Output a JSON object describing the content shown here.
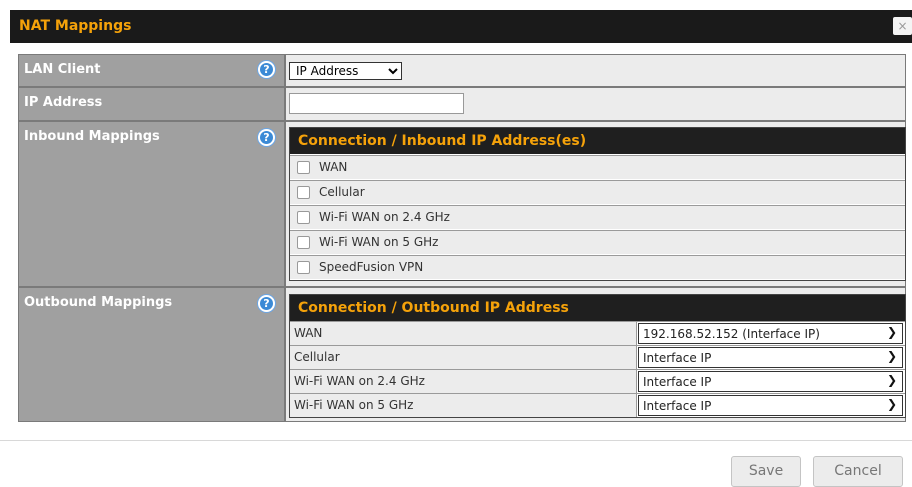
{
  "dialog": {
    "title": "NAT Mappings",
    "close_glyph": "×"
  },
  "lan_client": {
    "label": "LAN Client",
    "selected": "IP Address"
  },
  "ip_address": {
    "label": "IP Address",
    "value": ""
  },
  "inbound": {
    "label": "Inbound Mappings",
    "header": "Connection / Inbound IP Address(es)",
    "items": [
      {
        "label": "WAN",
        "checked": false
      },
      {
        "label": "Cellular",
        "checked": false
      },
      {
        "label": "Wi-Fi WAN on 2.4 GHz",
        "checked": false
      },
      {
        "label": "Wi-Fi WAN on 5 GHz",
        "checked": false
      },
      {
        "label": "SpeedFusion VPN",
        "checked": false
      }
    ]
  },
  "outbound": {
    "label": "Outbound Mappings",
    "header": "Connection / Outbound IP Address",
    "rows": [
      {
        "connection": "WAN",
        "value": "192.168.52.152 (Interface IP)"
      },
      {
        "connection": "Cellular",
        "value": "Interface IP"
      },
      {
        "connection": "Wi-Fi WAN on 2.4 GHz",
        "value": "Interface IP"
      },
      {
        "connection": "Wi-Fi WAN on 5 GHz",
        "value": "Interface IP"
      }
    ]
  },
  "help_glyph": "?",
  "buttons": {
    "save": "Save",
    "cancel": "Cancel"
  },
  "colors": {
    "title_bar": "#1a1a1a",
    "accent": "#f5a20a",
    "label_bg": "#a0a0a0",
    "help_icon": "#3b8ad6"
  }
}
